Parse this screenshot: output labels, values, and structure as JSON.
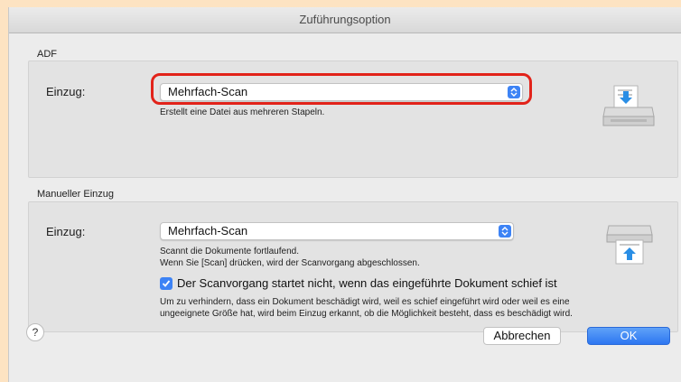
{
  "window": {
    "title": "Zuführungsoption"
  },
  "adf": {
    "section_label": "ADF",
    "field_label": "Einzug:",
    "selected_value": "Mehrfach-Scan",
    "description": "Erstellt eine Datei aus mehreren Stapeln.",
    "icon": "scanner-adf-icon"
  },
  "manual": {
    "section_label": "Manueller Einzug",
    "field_label": "Einzug:",
    "selected_value": "Mehrfach-Scan",
    "description_line1": "Scannt die Dokumente fortlaufend.",
    "description_line2": "Wenn Sie [Scan] drücken, wird der Scanvorgang abgeschlossen.",
    "checkbox_label": "Der Scanvorgang startet nicht, wenn das eingeführte Dokument schief ist",
    "checkbox_checked": true,
    "checkbox_desc_line1": "Um zu verhindern, dass ein Dokument beschädigt wird, weil es schief eingeführt wird oder weil es eine",
    "checkbox_desc_line2": "ungeeignete Größe hat, wird beim Einzug erkannt, ob die Möglichkeit besteht, dass es beschädigt wird.",
    "icon": "scanner-manual-feed-icon"
  },
  "footer": {
    "help_label": "?",
    "cancel_label": "Abbrechen",
    "ok_label": "OK"
  },
  "colors": {
    "accent": "#3d83f5",
    "highlight": "#e2231a",
    "page_background": "#fde3c2"
  }
}
